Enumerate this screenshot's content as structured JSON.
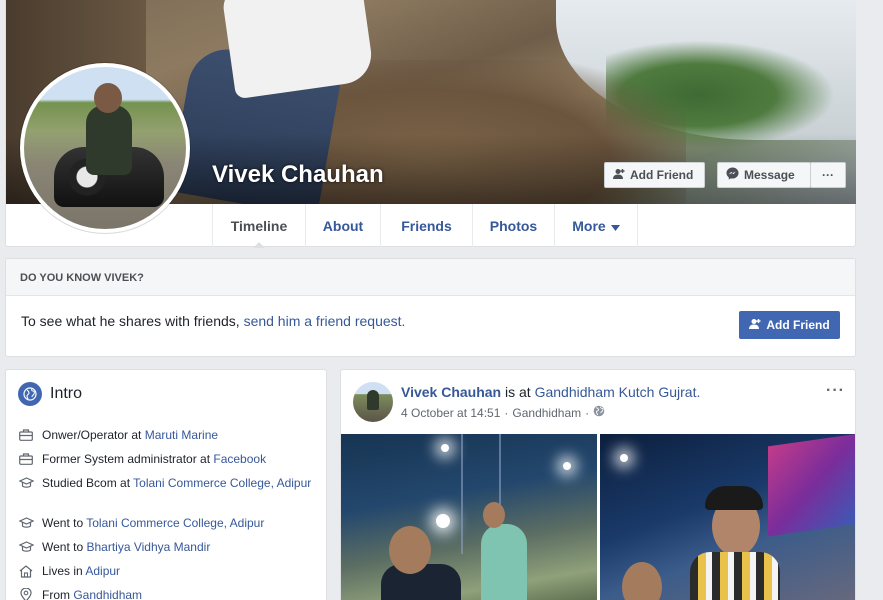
{
  "profile": {
    "name": "Vivek Chauhan",
    "add_friend": "Add Friend",
    "message": "Message",
    "more_dots": "···"
  },
  "tabs": [
    {
      "label": "Timeline"
    },
    {
      "label": "About"
    },
    {
      "label": "Friends"
    },
    {
      "label": "Photos"
    },
    {
      "label": "More"
    }
  ],
  "know": {
    "header": "DO YOU KNOW VIVEK?",
    "text_prefix": "To see what he shares with friends, ",
    "link": "send him a friend request.",
    "button": "Add Friend"
  },
  "intro": {
    "title": "Intro",
    "items": [
      {
        "icon": "briefcase-icon",
        "prefix": "Onwer/Operator at ",
        "link": "Maruti Marine"
      },
      {
        "icon": "briefcase-icon",
        "prefix": "Former System administrator at ",
        "link": "Facebook"
      },
      {
        "icon": "graduation-cap-icon",
        "prefix": "Studied Bcom at ",
        "link": "Tolani Commerce College, Adipur"
      },
      {
        "icon": "graduation-cap-icon",
        "prefix": "Went to ",
        "link": "Tolani Commerce College, Adipur"
      },
      {
        "icon": "graduation-cap-icon",
        "prefix": "Went to ",
        "link": "Bhartiya Vidhya Mandir"
      },
      {
        "icon": "home-icon",
        "prefix": "Lives in ",
        "link": "Adipur"
      },
      {
        "icon": "location-pin-icon",
        "prefix": "From ",
        "link": "Gandhidham"
      }
    ]
  },
  "post": {
    "author": "Vivek Chauhan",
    "action": " is at ",
    "place": "Gandhidham Kutch Gujrat.",
    "date": "4 October at 14:51",
    "separator": "·",
    "location": "Gandhidham",
    "dots": "···"
  },
  "colors": {
    "link": "#365899",
    "primary_button": "#4267b2",
    "background": "#e9ebee"
  }
}
